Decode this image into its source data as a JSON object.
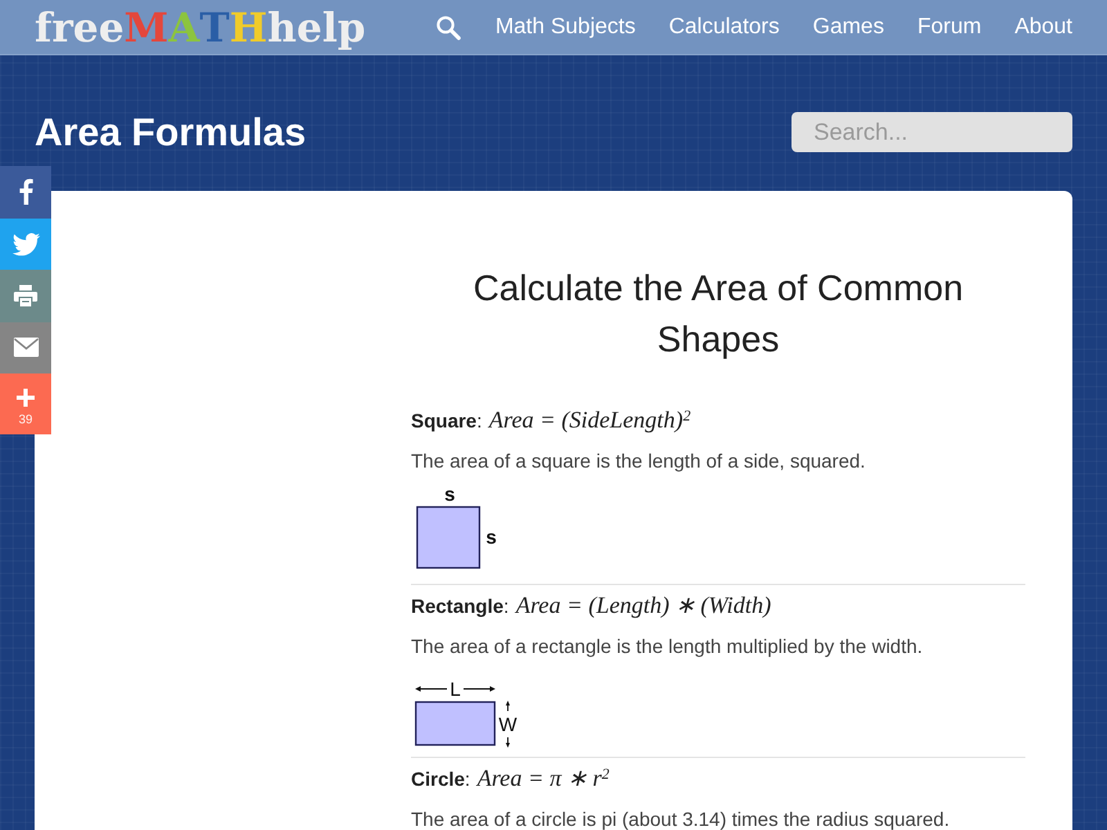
{
  "header": {
    "logo": [
      {
        "text": "free",
        "color": "#eeeeee"
      },
      {
        "text": "M",
        "color": "#e4473c"
      },
      {
        "text": "A",
        "color": "#8cc43f"
      },
      {
        "text": "T",
        "color": "#2a5ea6"
      },
      {
        "text": "H",
        "color": "#f0cb2a"
      },
      {
        "text": "help",
        "color": "#eeeeee"
      }
    ],
    "nav": [
      "Math Subjects",
      "Calculators",
      "Games",
      "Forum",
      "About"
    ]
  },
  "page_title": "Area Formulas",
  "search": {
    "placeholder": "Search..."
  },
  "social": [
    {
      "kind": "facebook"
    },
    {
      "kind": "twitter"
    },
    {
      "kind": "print"
    },
    {
      "kind": "email"
    },
    {
      "kind": "more",
      "count": "39"
    }
  ],
  "article": {
    "title": "Calculate the Area of Common Shapes",
    "sections": [
      {
        "label": "**Square**:",
        "formula": "Area = (SideLength)$^{2}$",
        "description": "The area of a square is the length of a side, squared.",
        "diagram": {
          "kind": "square",
          "top_label": "s",
          "side_label": "s"
        }
      },
      {
        "label": "**Rectangle**:",
        "formula": "Area = (Length) ∗ (Width)",
        "description": "The area of a rectangle is the length multiplied by the width.",
        "diagram": {
          "kind": "rectangle",
          "top_label": "L",
          "side_label": "W"
        }
      },
      {
        "label": "**Circle**:",
        "formula": "Area = π ∗ r$^{2}$",
        "description": "The area of a circle is pi (about 3.14) times the radius squared."
      }
    ]
  }
}
